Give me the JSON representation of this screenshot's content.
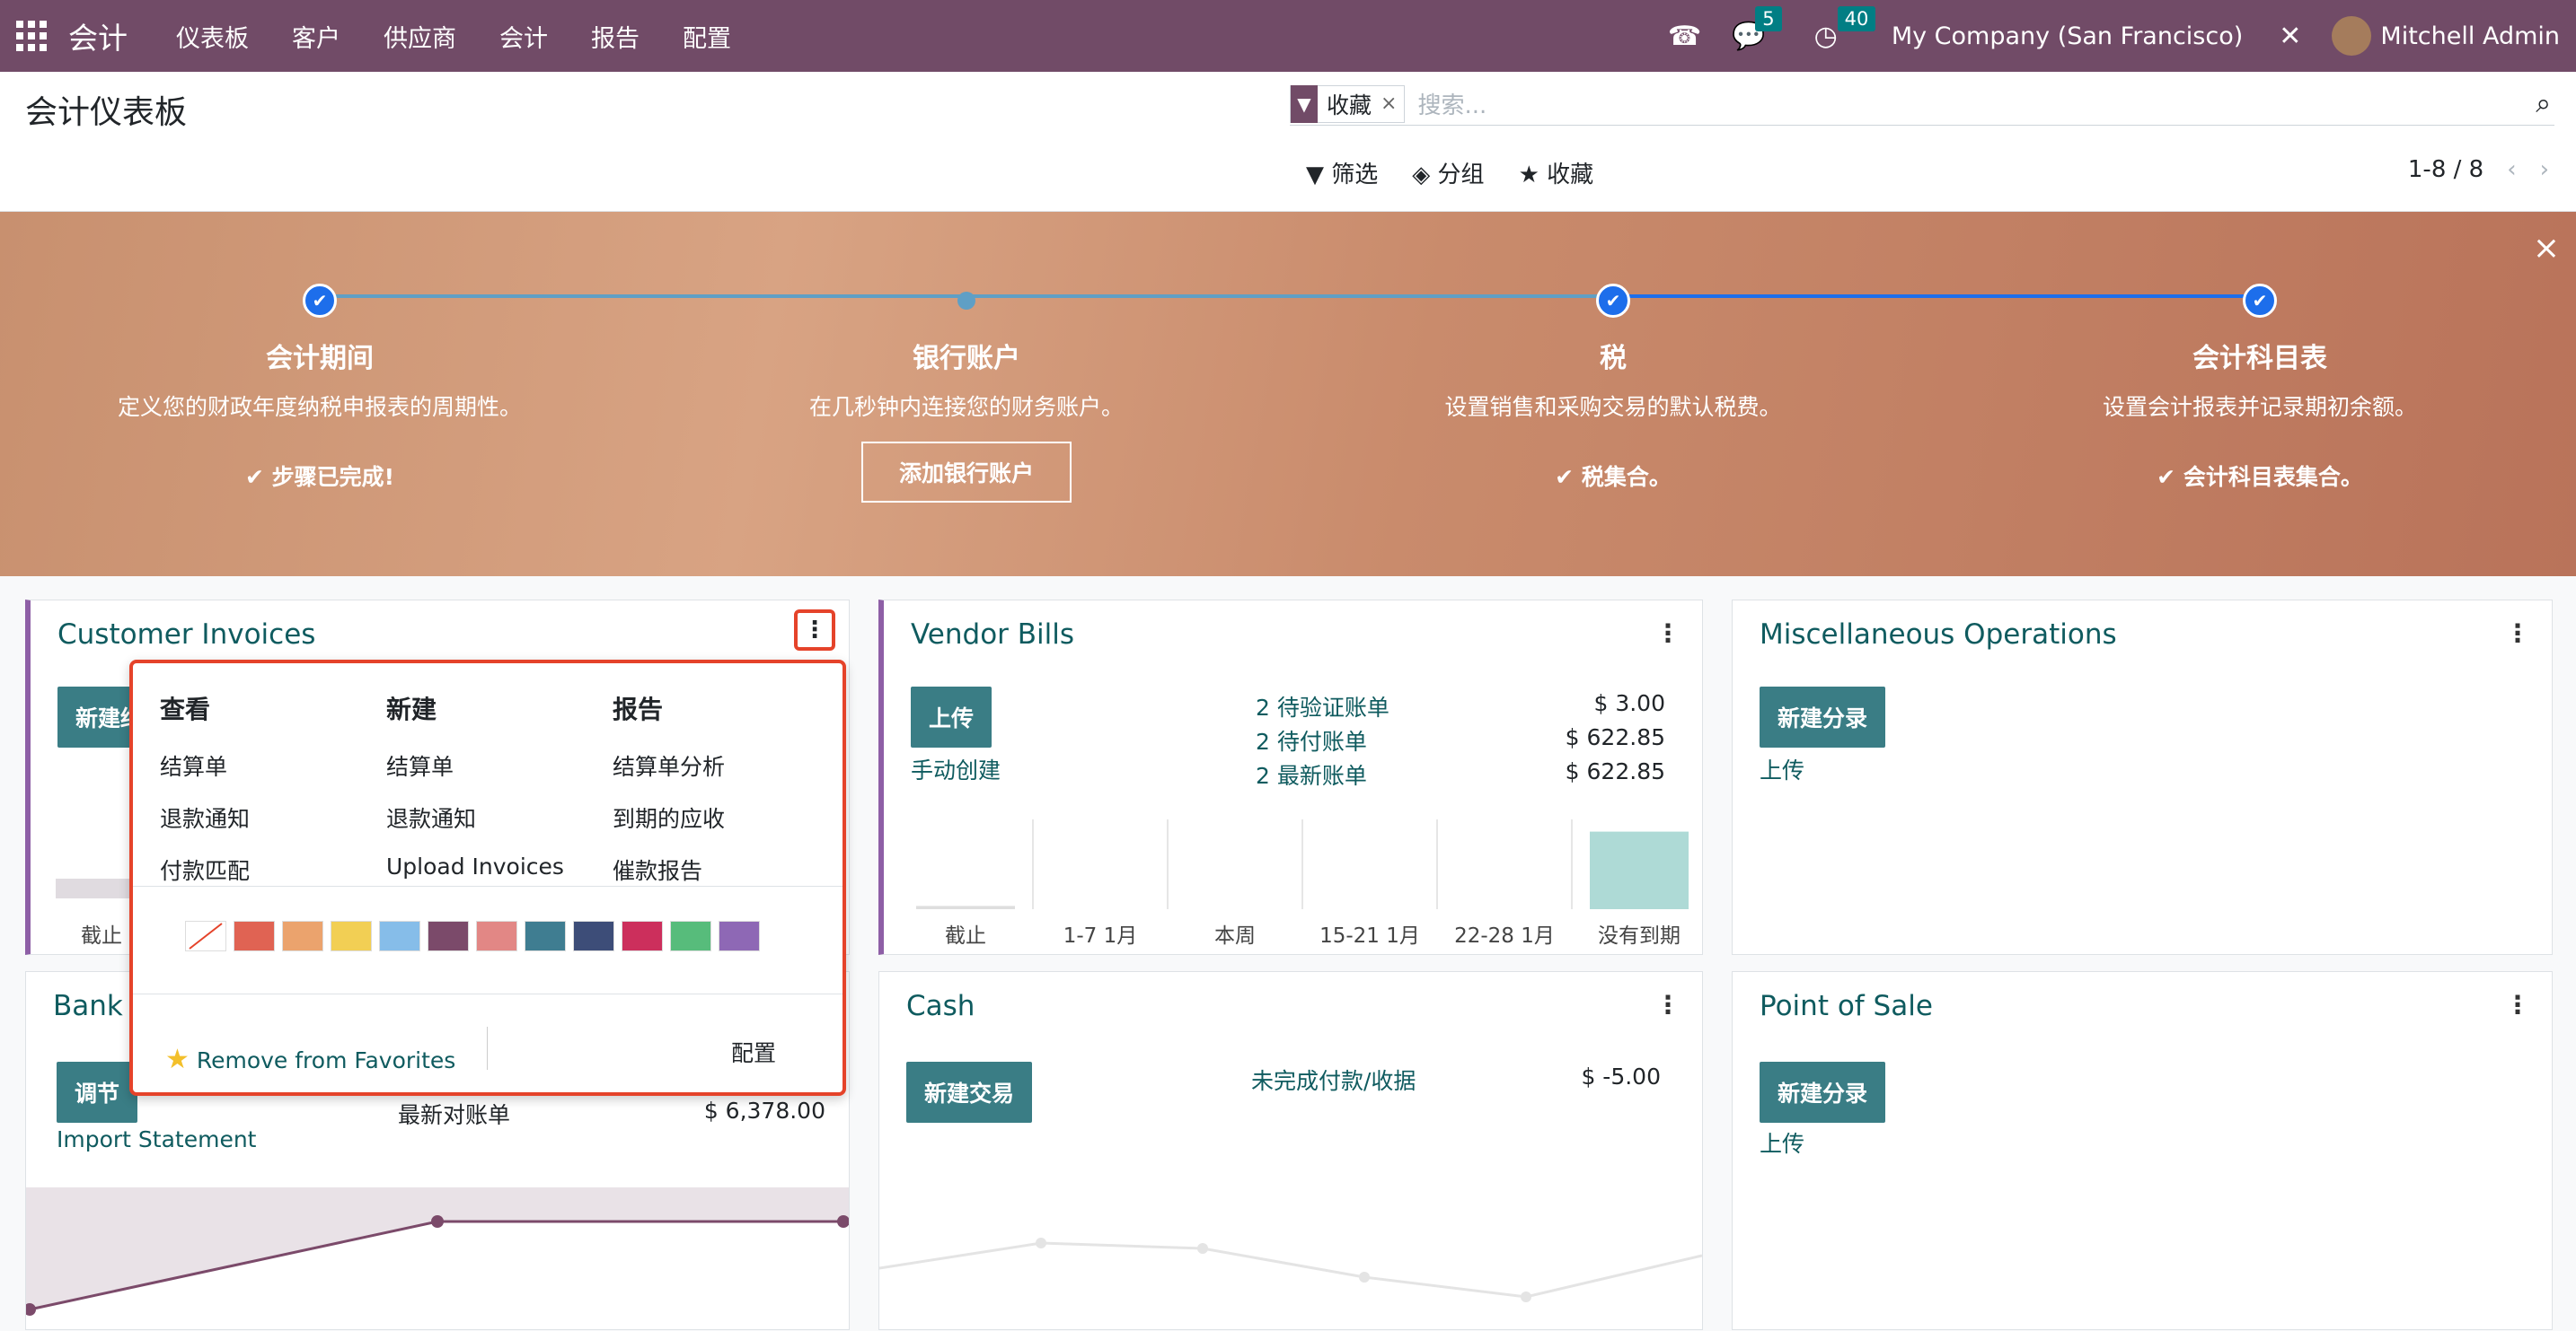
{
  "navbar": {
    "brand": "会计",
    "menus": [
      "仪表板",
      "客户",
      "供应商",
      "会计",
      "报告",
      "配置"
    ],
    "messages_count": "5",
    "activities_count": "40",
    "company": "My Company (San Francisco)",
    "user": "Mitchell Admin"
  },
  "control_panel": {
    "title": "会计仪表板",
    "facet_label": "收藏",
    "search_placeholder": "搜索...",
    "filter_label": "筛选",
    "group_label": "分组",
    "favorites_label": "收藏",
    "pager": "1-8 / 8"
  },
  "onboarding": {
    "steps": [
      {
        "title": "会计期间",
        "desc": "定义您的财政年度纳税申报表的周期性。",
        "status": "步骤已完成!",
        "done": true
      },
      {
        "title": "银行账户",
        "desc": "在几秒钟内连接您的财务账户。",
        "button": "添加银行账户",
        "done": false
      },
      {
        "title": "税",
        "desc": "设置销售和采购交易的默认税费。",
        "status": "税集合。",
        "done": true
      },
      {
        "title": "会计科目表",
        "desc": "设置会计报表并记录期初余额。",
        "status": "会计科目表集合。",
        "done": true
      }
    ]
  },
  "cards": {
    "customer_invoices": {
      "title": "Customer Invoices",
      "button": "新建结",
      "axis_first": "截止"
    },
    "vendor_bills": {
      "title": "Vendor Bills",
      "button": "上传",
      "link": "手动创建",
      "stats": [
        {
          "label": "2 待验证账单",
          "value": "$ 3.00"
        },
        {
          "label": "2 待付账单",
          "value": "$ 622.85"
        },
        {
          "label": "2 最新账单",
          "value": "$ 622.85"
        }
      ],
      "axis": [
        "截止",
        "1-7 1月",
        "本周",
        "15-21 1月",
        "22-28 1月",
        "没有到期"
      ],
      "bar_values": [
        0.02,
        0,
        0,
        0,
        0,
        0.48
      ]
    },
    "misc_operations": {
      "title": "Miscellaneous Operations",
      "button": "新建分录",
      "link": "上传"
    },
    "bank": {
      "title": "Bank",
      "button": "调节",
      "link": "Import Statement",
      "stat_label": "最新对账单",
      "stat_value": "$ 6,378.00"
    },
    "cash": {
      "title": "Cash",
      "button": "新建交易",
      "stat_label": "未完成付款/收据",
      "stat_value": "$ -5.00"
    },
    "point_of_sale": {
      "title": "Point of Sale",
      "button": "新建分录",
      "link": "上传"
    }
  },
  "dropdown": {
    "view_head": "查看",
    "view_items": [
      "结算单",
      "退款通知",
      "付款匹配"
    ],
    "new_head": "新建",
    "new_items": [
      "结算单",
      "退款通知",
      "Upload Invoices"
    ],
    "report_head": "报告",
    "report_items": [
      "结算单分析",
      "到期的应收",
      "催款报告"
    ],
    "colors": [
      "#ffffff",
      "#e06353",
      "#eba36d",
      "#f2cf54",
      "#86bde9",
      "#7b4a6a",
      "#e28785",
      "#3f7d91",
      "#3d4d78",
      "#cc2f5c",
      "#57bc7b",
      "#8e68b5"
    ],
    "remove_favorites": "Remove from Favorites",
    "configure": "配置"
  }
}
